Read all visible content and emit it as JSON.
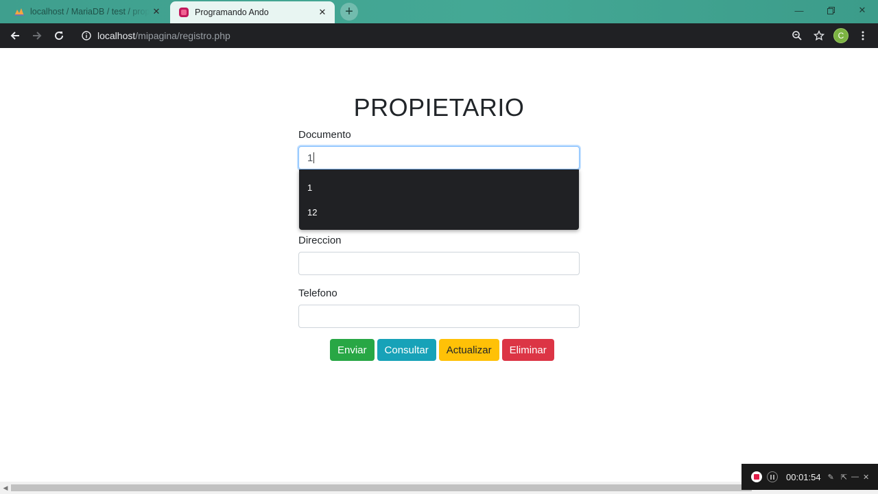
{
  "browser": {
    "tabs": [
      {
        "title": "localhost / MariaDB / test / propietario",
        "favicon": "phpmyadmin-icon",
        "active": false
      },
      {
        "title": "Programando Ando",
        "favicon": "app-icon",
        "active": true
      }
    ],
    "url_host": "localhost",
    "url_path": "/mipagina/registro.php",
    "profile_initial": "C"
  },
  "form": {
    "title": "PROPIETARIO",
    "documento": {
      "label": "Documento",
      "value": "1"
    },
    "autocomplete": [
      "1",
      "12"
    ],
    "direccion": {
      "label": "Direccion",
      "value": ""
    },
    "telefono": {
      "label": "Telefono",
      "value": ""
    }
  },
  "buttons": {
    "enviar": "Enviar",
    "consultar": "Consultar",
    "actualizar": "Actualizar",
    "eliminar": "Eliminar"
  },
  "recorder": {
    "time": "00:01:54"
  },
  "colors": {
    "success": "#28a745",
    "info": "#17a2b8",
    "warning": "#ffc107",
    "danger": "#dc3545",
    "tabbar": "#44a895"
  }
}
